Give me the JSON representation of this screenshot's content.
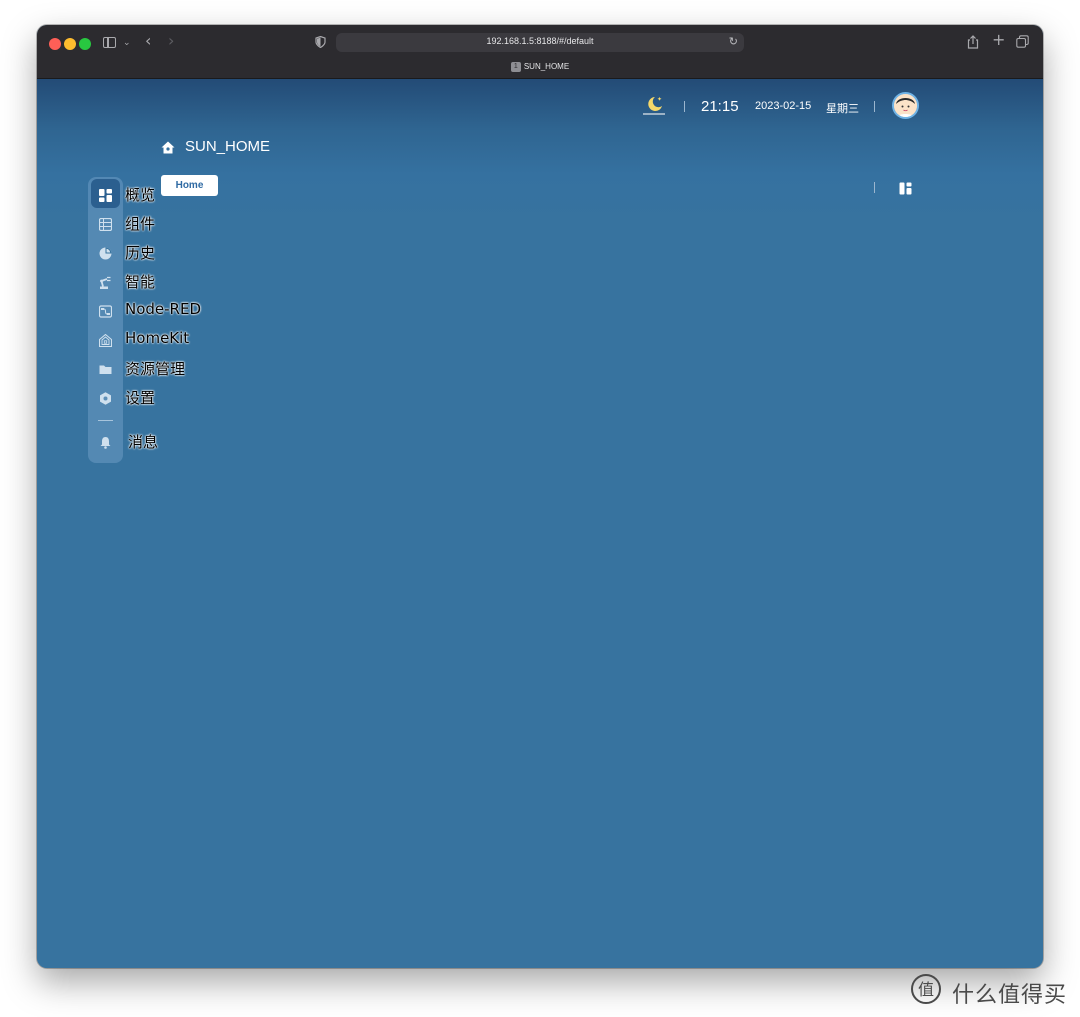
{
  "browser": {
    "url": "192.168.1.5:8188/#/default",
    "tab_title": "SUN_HOME",
    "tab_badge": "1"
  },
  "header": {
    "time": "21:15",
    "date": "2023-02-15",
    "weekday": "星期三",
    "theme_icon": "moon-night-icon",
    "avatar_icon": "user-avatar"
  },
  "page": {
    "title": "SUN_HOME",
    "tab_label": "Home"
  },
  "sidebar": {
    "items": [
      {
        "label": "概览",
        "icon": "dashboard-grid-icon",
        "active": true
      },
      {
        "label": "组件",
        "icon": "table-icon",
        "active": false
      },
      {
        "label": "历史",
        "icon": "chart-pie-icon",
        "active": false
      },
      {
        "label": "智能",
        "icon": "robot-arm-icon",
        "active": false
      },
      {
        "label": "Node-RED",
        "icon": "sitemap-icon",
        "active": false
      },
      {
        "label": "HomeKit",
        "icon": "homekit-icon",
        "active": false
      },
      {
        "label": "资源管理",
        "icon": "folder-icon",
        "active": false
      },
      {
        "label": "设置",
        "icon": "cog-icon",
        "active": false
      }
    ],
    "notifications_label": "消息"
  },
  "watermark": {
    "text": "什么值得买",
    "logo_char": "值"
  },
  "colors": {
    "background": "#37739f",
    "header_gradient_top": "#234b76",
    "active_nav": "#2b5f8f",
    "tab_text": "#2f6aa3"
  }
}
